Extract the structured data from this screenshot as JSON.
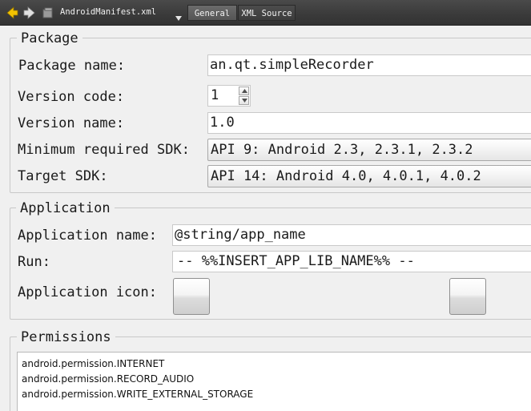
{
  "toolbar": {
    "back_icon": "arrow-left-icon",
    "forward_icon": "arrow-right-icon",
    "file_icon": "file-icon",
    "file_name": "AndroidManifest.xml",
    "tabs": [
      {
        "label": "General",
        "active": true
      },
      {
        "label": "XML Source",
        "active": false
      }
    ]
  },
  "package": {
    "title": "Package",
    "package_name_label": "Package name:",
    "package_name_value": "an.qt.simpleRecorder",
    "version_code_label": "Version code:",
    "version_code_value": "1",
    "version_name_label": "Version name:",
    "version_name_value": "1.0",
    "min_sdk_label": "Minimum required SDK:",
    "min_sdk_value": "API 9: Android 2.3, 2.3.1, 2.3.2",
    "target_sdk_label": "Target SDK:",
    "target_sdk_value": "API 14: Android 4.0, 4.0.1, 4.0.2"
  },
  "application": {
    "title": "Application",
    "name_label": "Application name:",
    "name_value": "@string/app_name",
    "run_label": "Run:",
    "run_value": "-- %%INSERT_APP_LIB_NAME%% --",
    "icon_label": "Application icon:"
  },
  "permissions": {
    "title": "Permissions",
    "items": [
      "android.permission.INTERNET",
      "android.permission.RECORD_AUDIO",
      "android.permission.WRITE_EXTERNAL_STORAGE"
    ]
  },
  "colors": {
    "toolbar_bg": "#3a3a3a",
    "nav_arrow": "#f2c200",
    "panel_bg": "#f0f0f0"
  }
}
